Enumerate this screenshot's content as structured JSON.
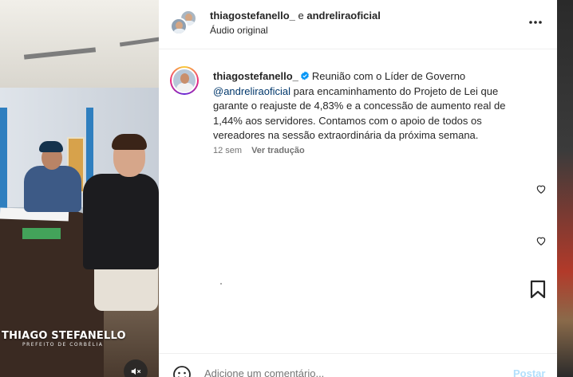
{
  "media": {
    "watermark_name": "THIAGO STEFANELLO",
    "watermark_sub": "PREFEITO DE CORBÉLIA"
  },
  "header": {
    "user1": "thiagostefanello_",
    "separator": " e ",
    "user2": "andreliraoficial",
    "audio": "Áudio original"
  },
  "caption": {
    "username": "thiagostefanello_",
    "text_before_mention": "Reunião com o Líder de Governo ",
    "mention": "@andreliraoficial",
    "text_after_mention": " para encaminhamento do Projeto de Lei que garante o reajuste de 4,83% e a concessão de aumento real de 1,44% aos servidores. Contamos com o apoio de todos os vereadores na sessão extraordinária da próxima semana.",
    "time_ago": "12 sem",
    "translate_label": "Ver tradução"
  },
  "comment": {
    "placeholder": "Adicione um comentário...",
    "post_label": "Postar"
  },
  "colors": {
    "link": "#00376b",
    "verified": "#0095f6",
    "post_disabled": "#b2dffc"
  },
  "icons": {
    "more": "more-horizontal-icon",
    "heart": "heart-icon",
    "bookmark": "bookmark-icon",
    "emoji": "emoji-icon",
    "mute": "speaker-muted-icon",
    "verified": "verified-badge-icon"
  }
}
